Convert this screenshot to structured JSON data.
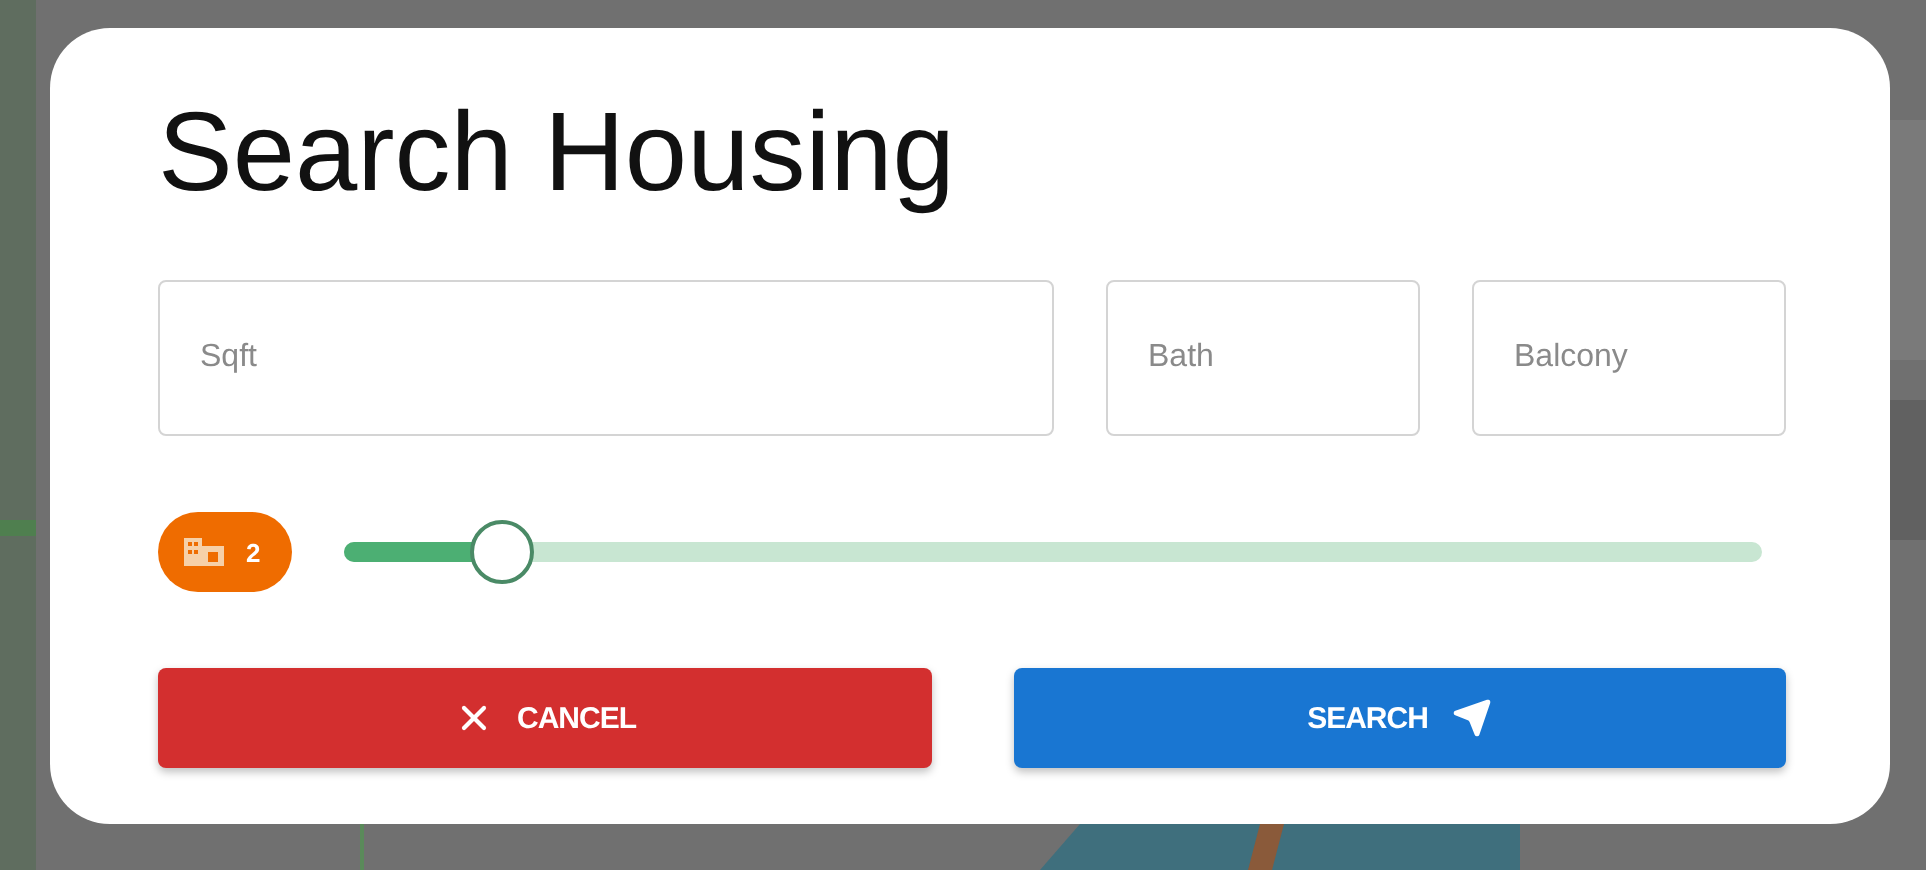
{
  "dialog": {
    "title": "Search Housing",
    "fields": [
      {
        "placeholder": "Sqft"
      },
      {
        "placeholder": "Bath"
      },
      {
        "placeholder": "Balcony"
      }
    ],
    "slider": {
      "badge": "2",
      "level": 0.11
    },
    "buttons": [
      {
        "label": "CANCEL",
        "kind": "cancel"
      },
      {
        "label": "SEARCH",
        "kind": "search"
      }
    ]
  }
}
